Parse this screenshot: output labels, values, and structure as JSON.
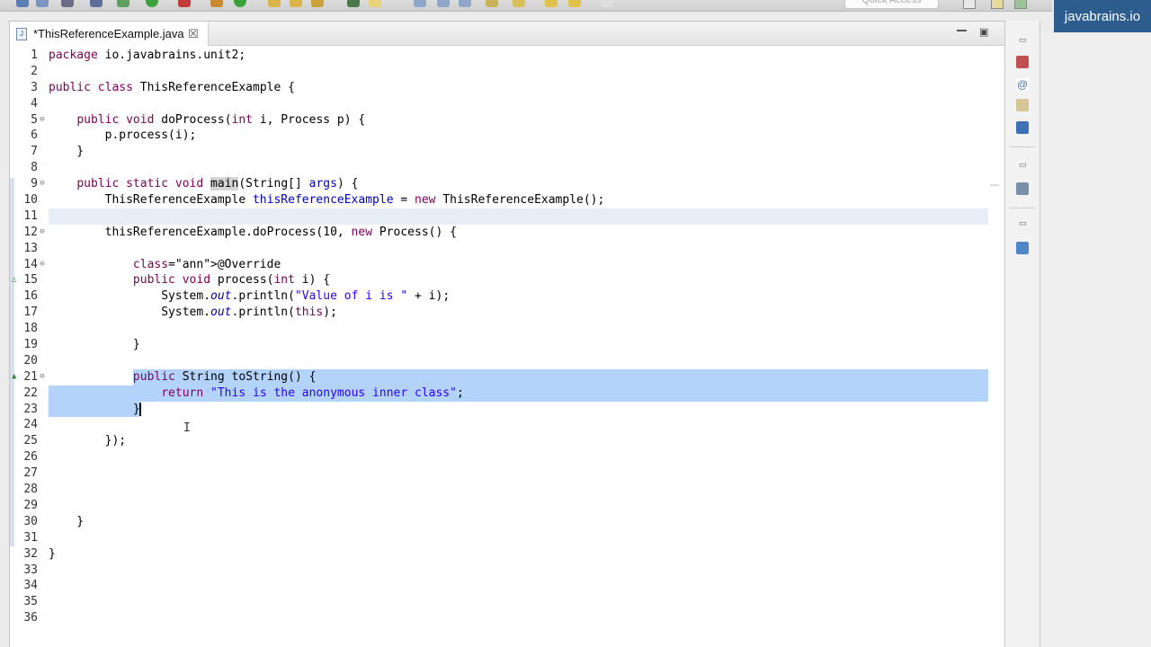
{
  "toolbar": {
    "quick_access_placeholder": "Quick Access"
  },
  "brand": {
    "label": "javabrains.io"
  },
  "editor": {
    "tab_label": "*ThisReferenceExample.java",
    "close_glyph": "☒"
  },
  "code_lines": [
    {
      "n": "1",
      "html": "package io.javabrains.unit2;"
    },
    {
      "n": "2",
      "html": ""
    },
    {
      "n": "3",
      "html": "public class ThisReferenceExample {"
    },
    {
      "n": "4",
      "html": ""
    },
    {
      "n": "5",
      "html": "    public void doProcess(int i, Process p) {"
    },
    {
      "n": "6",
      "html": "        p.process(i);"
    },
    {
      "n": "7",
      "html": "    }"
    },
    {
      "n": "8",
      "html": ""
    },
    {
      "n": "9",
      "html": "    public static void main(String[] args) {"
    },
    {
      "n": "10",
      "html": "        ThisReferenceExample thisReferenceExample = new ThisReferenceExample();"
    },
    {
      "n": "11",
      "html": ""
    },
    {
      "n": "12",
      "html": "        thisReferenceExample.doProcess(10, new Process() {"
    },
    {
      "n": "13",
      "html": ""
    },
    {
      "n": "14",
      "html": "            @Override"
    },
    {
      "n": "15",
      "html": "            public void process(int i) {"
    },
    {
      "n": "16",
      "html": "                System.out.println(\"Value of i is \" + i);"
    },
    {
      "n": "17",
      "html": "                System.out.println(this);"
    },
    {
      "n": "18",
      "html": ""
    },
    {
      "n": "19",
      "html": "            }"
    },
    {
      "n": "20",
      "html": ""
    },
    {
      "n": "21",
      "html": "            public String toString() {"
    },
    {
      "n": "22",
      "html": "                return \"This is the anonymous inner class\";"
    },
    {
      "n": "23",
      "html": "            }"
    },
    {
      "n": "24",
      "html": ""
    },
    {
      "n": "25",
      "html": "        });"
    },
    {
      "n": "26",
      "html": ""
    },
    {
      "n": "27",
      "html": ""
    },
    {
      "n": "28",
      "html": ""
    },
    {
      "n": "29",
      "html": ""
    },
    {
      "n": "30",
      "html": "    }"
    },
    {
      "n": "31",
      "html": ""
    },
    {
      "n": "32",
      "html": "}"
    },
    {
      "n": "33",
      "html": ""
    },
    {
      "n": "34",
      "html": ""
    },
    {
      "n": "35",
      "html": ""
    },
    {
      "n": "36",
      "html": ""
    }
  ],
  "colors": {
    "keyword": "#7f0055",
    "string": "#2a00ff",
    "field": "#0000c0",
    "annotation": "#646464",
    "selection": "#b3d3fa",
    "brand_bg": "#2d5d8f"
  },
  "icons": {
    "toolbar": [
      "save-icon",
      "save-all-icon",
      "print-icon",
      "search-icon",
      "debug-icon",
      "run-icon",
      "stop-icon",
      "new-java-class-icon",
      "open-type-icon",
      "open-folder-icon",
      "next-annotation-icon",
      "previous-annotation-icon",
      "back-icon",
      "forward-icon"
    ],
    "side_panel": [
      "restore-icon",
      "task-list-icon",
      "javadoc-icon",
      "declaration-icon",
      "console-icon",
      "outline-icon"
    ]
  }
}
